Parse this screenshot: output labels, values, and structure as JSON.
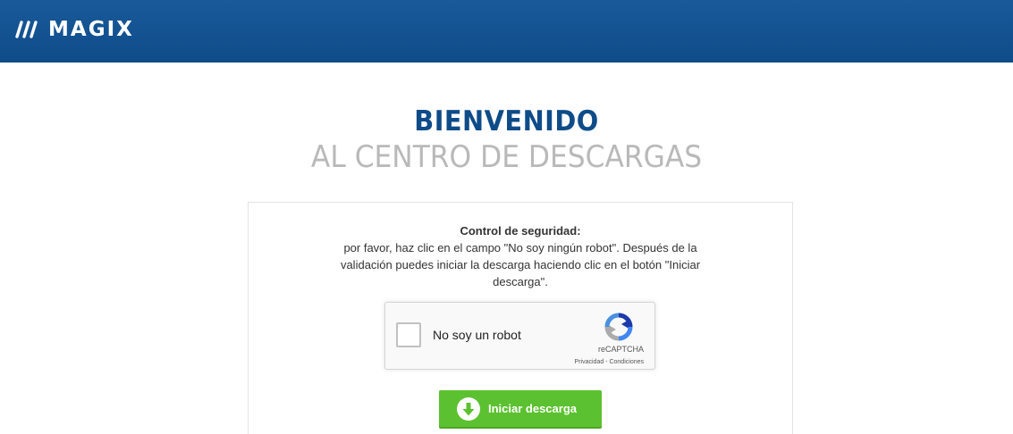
{
  "header": {
    "logo_text": "MAGIX"
  },
  "heading": {
    "title": "BIENVENIDO",
    "subtitle": "AL CENTRO DE DESCARGAS"
  },
  "notice": {
    "title": "Control de seguridad:",
    "body": "por favor, haz clic en el campo \"No soy ningún robot\". Después de la validación puedes iniciar la descarga haciendo clic en el botón \"Iniciar descarga\"."
  },
  "captcha": {
    "label": "No soy un robot",
    "brand": "reCAPTCHA",
    "privacy": "Privacidad",
    "separator": " - ",
    "terms": "Condiciones",
    "checked": false
  },
  "download": {
    "label": "Iniciar descarga"
  },
  "colors": {
    "header_bg": "#0e4b89",
    "title": "#0e4b89",
    "subtitle": "#b9b9b9",
    "button_bg": "#5cc130"
  },
  "icons": {
    "logo": "magix-slashes-icon",
    "captcha": "recaptcha-icon",
    "download": "download-arrow-icon"
  }
}
